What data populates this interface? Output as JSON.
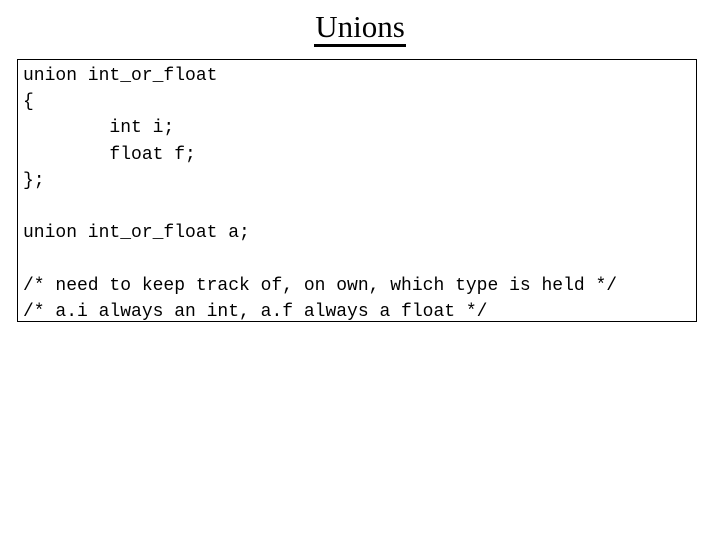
{
  "slide": {
    "title": "Unions",
    "background_color": "#ffffff",
    "text_color": "#000000"
  },
  "code_box": {
    "border_color": "#000000",
    "background_color": "#ffffff",
    "lines": [
      {
        "text": "union int_or_float",
        "blank": false
      },
      {
        "text": "{",
        "blank": false
      },
      {
        "text": "        int i;",
        "blank": false
      },
      {
        "text": "        float f;",
        "blank": false
      },
      {
        "text": "};",
        "blank": false
      },
      {
        "text": " ",
        "blank": true
      },
      {
        "text": "union int_or_float a;",
        "blank": false
      },
      {
        "text": " ",
        "blank": true
      },
      {
        "text": "/* need to keep track of, on own, which type is held */",
        "blank": false
      },
      {
        "text": "/* a.i always an int, a.f always a float */",
        "blank": false
      }
    ]
  }
}
